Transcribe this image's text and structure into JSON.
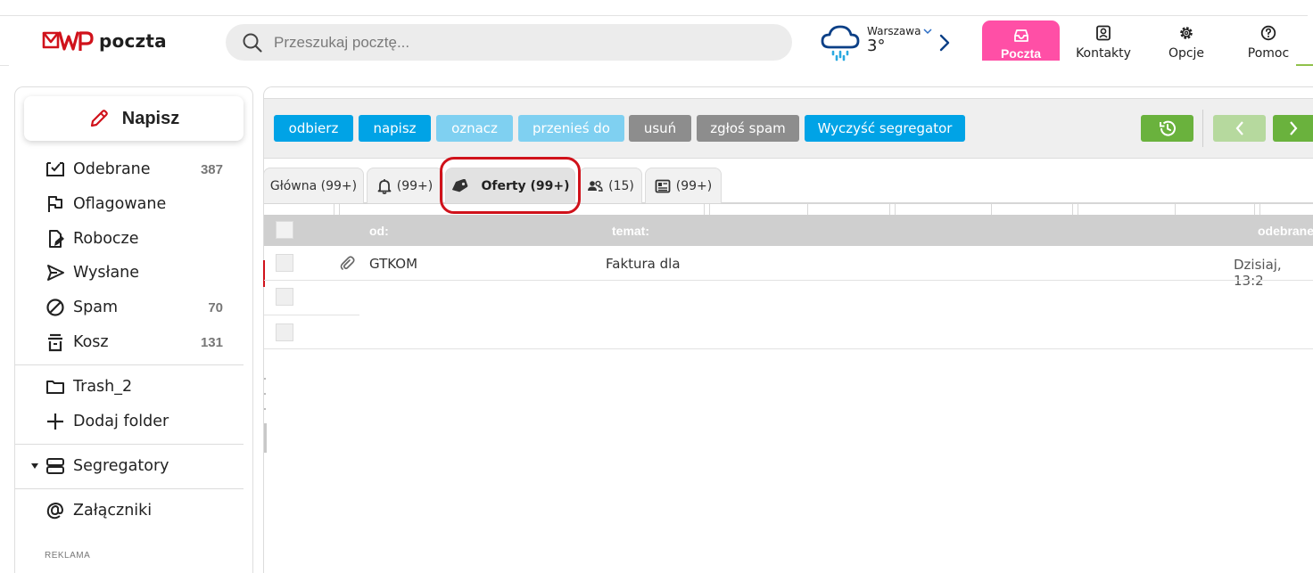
{
  "app": {
    "logo_text": "poczta"
  },
  "search": {
    "placeholder": "Przeszukaj pocztę..."
  },
  "weather": {
    "city": "Warszawa",
    "temp": "3°"
  },
  "nav": {
    "poczta": "Poczta",
    "kontakty": "Kontakty",
    "opcje": "Opcje",
    "pomoc": "Pomoc"
  },
  "sidebar": {
    "compose": "Napisz",
    "folders": [
      {
        "label": "Odebrane",
        "count": "387",
        "icon": "inbox-icon"
      },
      {
        "label": "Oflagowane",
        "count": "",
        "icon": "flag-icon"
      },
      {
        "label": "Robocze",
        "count": "",
        "icon": "draft-icon"
      },
      {
        "label": "Wysłane",
        "count": "",
        "icon": "send-icon"
      },
      {
        "label": "Spam",
        "count": "70",
        "icon": "spam-icon"
      },
      {
        "label": "Kosz",
        "count": "131",
        "icon": "trash-icon"
      }
    ],
    "custom": [
      {
        "label": "Trash_2",
        "icon": "folder-icon"
      },
      {
        "label": "Dodaj folder",
        "icon": "plus-icon"
      }
    ],
    "segregatory": "Segregatory",
    "zalaczniki": "Załączniki",
    "ad_label": "REKLAMA"
  },
  "toolbar": {
    "buttons": [
      "odbierz",
      "napisz",
      "oznacz",
      "przenieś do",
      "usuń",
      "zgłoś spam",
      "Wyczyść segregator"
    ]
  },
  "tabs": [
    {
      "label": "Główna (99+)",
      "icon": ""
    },
    {
      "label": "(99+)",
      "icon": "bell-icon"
    },
    {
      "label": "Oferty (99+)",
      "icon": "tag-icon",
      "active": true
    },
    {
      "label": "(15)",
      "icon": "people-icon"
    },
    {
      "label": "(99+)",
      "icon": "newsletter-icon"
    }
  ],
  "list": {
    "headers": {
      "from": "od:",
      "subject": "temat:",
      "received": "odebrane"
    },
    "rows": [
      {
        "from": "GTKOM",
        "subject": "Faktura dla",
        "date": "Dzisiaj, 13:2",
        "attachment": true
      }
    ]
  },
  "colors": {
    "accent_pink": "#ff4fa6",
    "button_blue": "#00a3e6",
    "button_gray": "#8d8d8d",
    "button_green": "#6ab23d",
    "highlight_red": "#d0121b"
  }
}
